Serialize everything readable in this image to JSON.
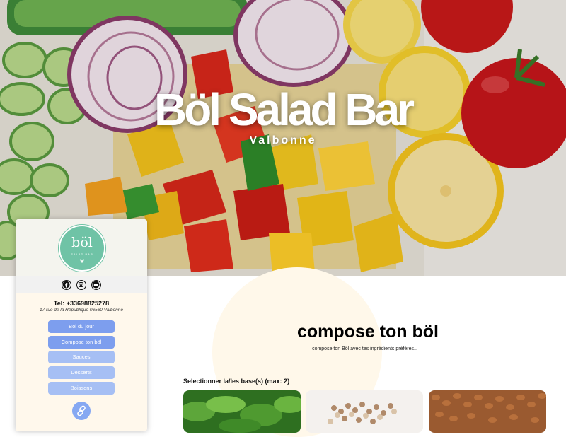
{
  "hero": {
    "title": "Böl Salad Bar",
    "subtitle": "Valbonne"
  },
  "sidebar": {
    "logo": {
      "brand": "böl",
      "tagline": "SALAD BAR"
    },
    "social": [
      {
        "icon": "facebook-icon"
      },
      {
        "icon": "instagram-icon"
      },
      {
        "icon": "tripadvisor-icon"
      }
    ],
    "phone": "Tel: +33698825278",
    "address": "17 rue de la République 06560 Valbonne",
    "menu": [
      {
        "label": "Böl du jour"
      },
      {
        "label": "Compose ton böl"
      },
      {
        "label": "Sauces"
      },
      {
        "label": "Desserts"
      },
      {
        "label": "Boissons"
      }
    ],
    "link_icon": "link-icon"
  },
  "main": {
    "title": "compose ton böl",
    "subtitle": "compose ton Böl avec tes ingrédients préférés..",
    "bases_label": "Selectionner la/les base(s) (max: 2)",
    "cards": [
      {
        "image": "salad-leaves"
      },
      {
        "image": "quinoa-grains"
      },
      {
        "image": "brown-lentils"
      }
    ]
  },
  "colors": {
    "accent": "#7d9eee",
    "accent_light": "#a6bff4",
    "logo_green": "#6fc3a6",
    "cream": "#fff8ec"
  }
}
